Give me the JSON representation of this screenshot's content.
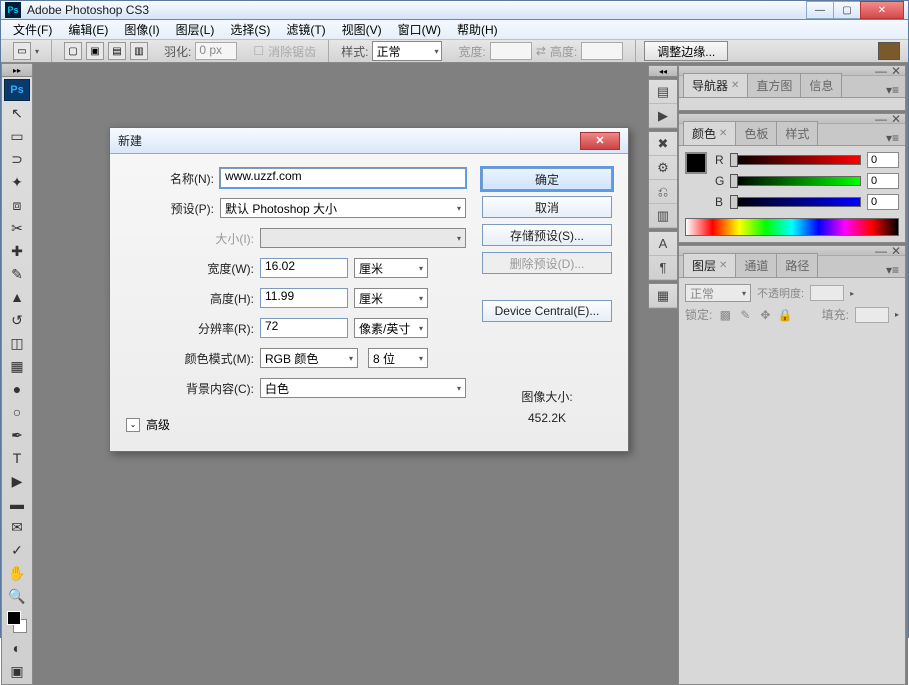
{
  "app": {
    "title": "Adobe Photoshop CS3",
    "icon_text": "Ps"
  },
  "window_controls": {
    "min": "—",
    "max": "▢",
    "close": "✕"
  },
  "menus": [
    "文件(F)",
    "编辑(E)",
    "图像(I)",
    "图层(L)",
    "选择(S)",
    "滤镜(T)",
    "视图(V)",
    "窗口(W)",
    "帮助(H)"
  ],
  "options": {
    "feather_label": "羽化:",
    "feather_value": "0 px",
    "antialias": "消除锯齿",
    "style_label": "样式:",
    "style_value": "正常",
    "width_label": "宽度:",
    "swap": "⇄",
    "height_label": "高度:",
    "refine_edge": "调整边缘..."
  },
  "panels": {
    "nav": {
      "tabs": [
        "导航器",
        "直方图",
        "信息"
      ]
    },
    "color": {
      "tabs": [
        "颜色",
        "色板",
        "样式"
      ],
      "sliders": [
        {
          "label": "R",
          "value": "0"
        },
        {
          "label": "G",
          "value": "0"
        },
        {
          "label": "B",
          "value": "0"
        }
      ]
    },
    "layers": {
      "tabs": [
        "图层",
        "通道",
        "路径"
      ],
      "blend": "正常",
      "opacity_label": "不透明度:",
      "lock_label": "锁定:",
      "fill_label": "填充:"
    }
  },
  "dialog": {
    "title": "新建",
    "name_label": "名称(N):",
    "name_value": "www.uzzf.com",
    "preset_label": "预设(P):",
    "preset_value": "默认 Photoshop 大小",
    "size_label": "大小(I):",
    "width_label": "宽度(W):",
    "width_value": "16.02",
    "width_unit": "厘米",
    "height_label": "高度(H):",
    "height_value": "11.99",
    "height_unit": "厘米",
    "res_label": "分辨率(R):",
    "res_value": "72",
    "res_unit": "像素/英寸",
    "mode_label": "颜色模式(M):",
    "mode_value": "RGB 颜色",
    "bit_value": "8 位",
    "bg_label": "背景内容(C):",
    "bg_value": "白色",
    "advanced": "高级",
    "buttons": {
      "ok": "确定",
      "cancel": "取消",
      "save_preset": "存储预设(S)...",
      "delete_preset": "删除预设(D)...",
      "device_central": "Device Central(E)..."
    },
    "image_size_label": "图像大小:",
    "image_size_value": "452.2K"
  }
}
